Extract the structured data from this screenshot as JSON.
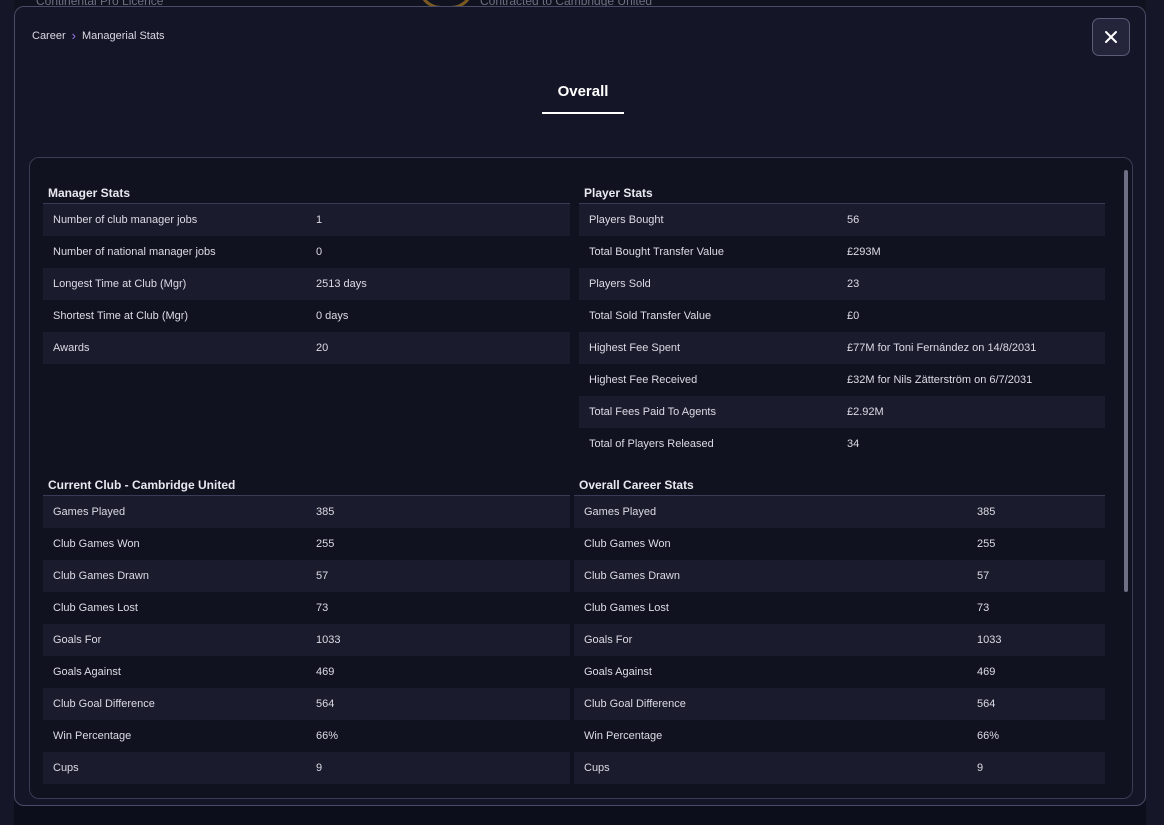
{
  "background": {
    "top_left_text": "Continental Pro Licence",
    "top_center_text": "Contracted to Cambridge United"
  },
  "breadcrumb": {
    "parent": "Career",
    "current": "Managerial Stats"
  },
  "tab": {
    "label": "Overall"
  },
  "close_icon": "close-icon",
  "manager_stats": {
    "title": "Manager Stats",
    "rows": [
      {
        "label": "Number of club manager jobs",
        "value": "1"
      },
      {
        "label": "Number of national manager jobs",
        "value": "0"
      },
      {
        "label": "Longest Time at Club (Mgr)",
        "value": "2513 days"
      },
      {
        "label": "Shortest Time at Club (Mgr)",
        "value": "0 days"
      },
      {
        "label": "Awards",
        "value": "20"
      }
    ]
  },
  "player_stats": {
    "title": "Player Stats",
    "rows": [
      {
        "label": "Players Bought",
        "value": "56"
      },
      {
        "label": "Total Bought Transfer Value",
        "value": "£293M"
      },
      {
        "label": "Players Sold",
        "value": "23"
      },
      {
        "label": "Total Sold Transfer Value",
        "value": "£0"
      },
      {
        "label": "Highest Fee Spent",
        "value": "£77M for Toni Fernández on 14/8/2031"
      },
      {
        "label": "Highest Fee Received",
        "value": "£32M for Nils Zätterström on 6/7/2031"
      },
      {
        "label": "Total Fees Paid To Agents",
        "value": "£2.92M"
      },
      {
        "label": "Total of Players Released",
        "value": "34"
      }
    ]
  },
  "current_club": {
    "title": "Current Club - Cambridge United",
    "rows": [
      {
        "label": "Games Played",
        "value": "385"
      },
      {
        "label": "Club Games Won",
        "value": "255"
      },
      {
        "label": "Club Games Drawn",
        "value": "57"
      },
      {
        "label": "Club Games Lost",
        "value": "73"
      },
      {
        "label": "Goals For",
        "value": "1033"
      },
      {
        "label": "Goals Against",
        "value": "469"
      },
      {
        "label": "Club Goal Difference",
        "value": "564"
      },
      {
        "label": "Win Percentage",
        "value": "66%"
      },
      {
        "label": "Cups",
        "value": "9"
      }
    ]
  },
  "career_stats": {
    "title": "Overall Career Stats",
    "rows": [
      {
        "label": "Games Played",
        "value": "385"
      },
      {
        "label": "Club Games Won",
        "value": "255"
      },
      {
        "label": "Club Games Drawn",
        "value": "57"
      },
      {
        "label": "Club Games Lost",
        "value": "73"
      },
      {
        "label": "Goals For",
        "value": "1033"
      },
      {
        "label": "Goals Against",
        "value": "469"
      },
      {
        "label": "Club Goal Difference",
        "value": "564"
      },
      {
        "label": "Win Percentage",
        "value": "66%"
      },
      {
        "label": "Cups",
        "value": "9"
      }
    ]
  }
}
